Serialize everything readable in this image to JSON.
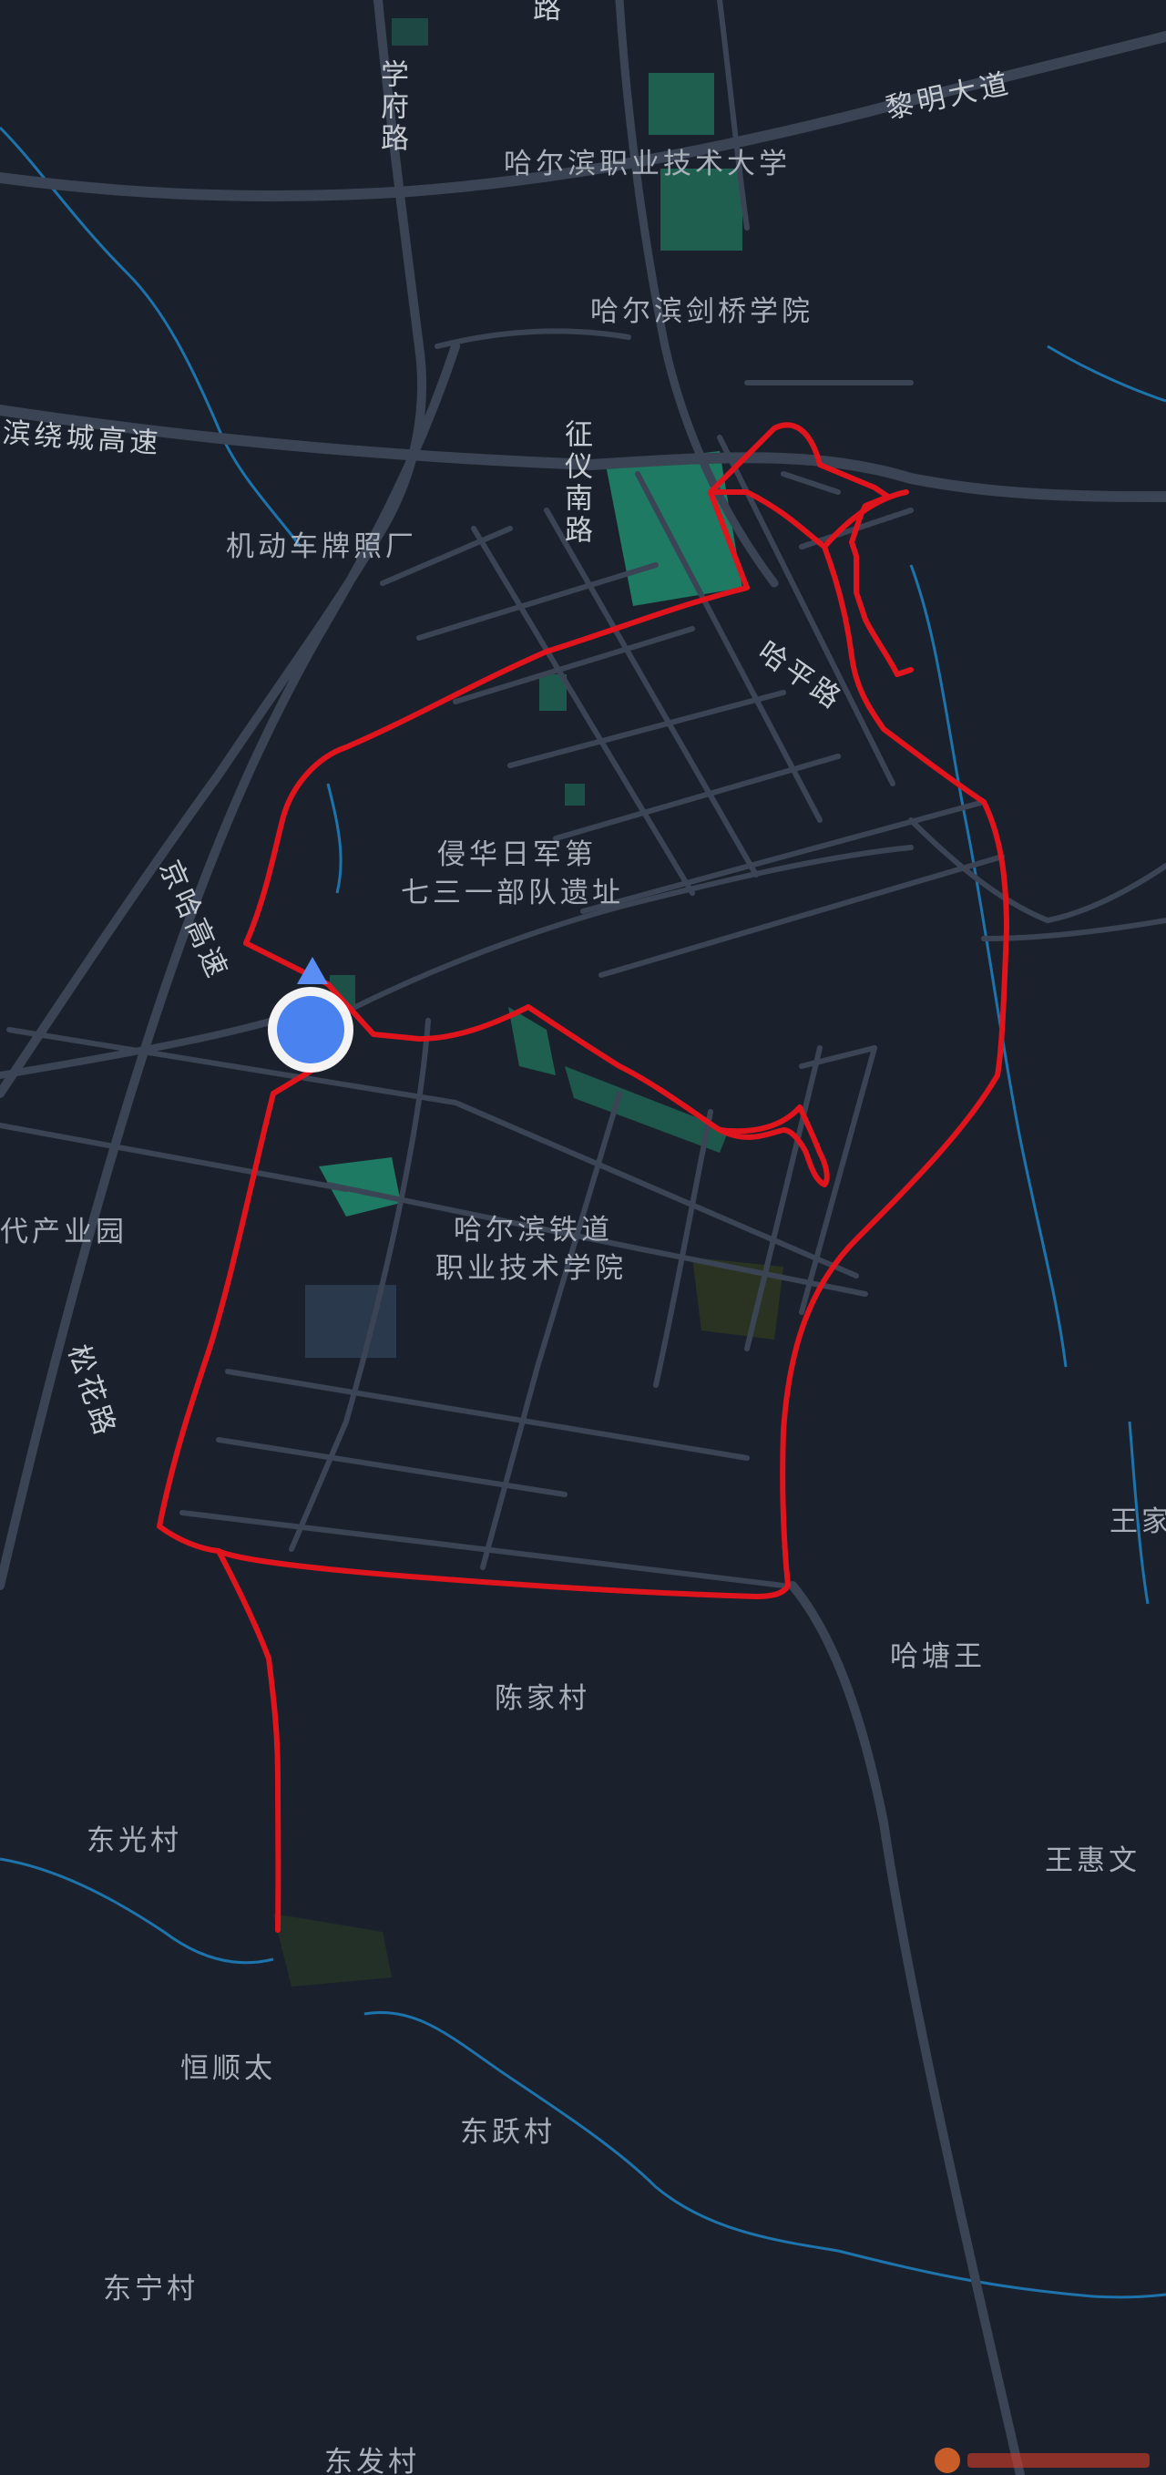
{
  "map": {
    "background": "#1b212c",
    "road_color": "#3b4454",
    "water_color": "#1f8fd6",
    "park_color": "#1f6f5a",
    "route_color": "#e0141c",
    "location_color": "#4a82f0"
  },
  "labels": {
    "xuefu_road_top": "路",
    "xuefu_road": "学府路",
    "liming_avenue": "黎明大道",
    "harbin_vocational_tech_univ": "哈尔滨职业技术大学",
    "harbin_cambridge_college": "哈尔滨剑桥学院",
    "ring_expressway": "滨绕城高速",
    "zhengyi_south_road": "征仪南路",
    "motor_vehicle_plate": "机动车牌照厂",
    "haping_road": "哈平路",
    "unit731_line1": "侵华日军第",
    "unit731_line2": "七三一部队遗址",
    "jingha_expressway": "京哈高速",
    "industrial_park": "代产业园",
    "railway_college_line1": "哈尔滨铁道",
    "railway_college_line2": "职业技术学院",
    "songhua_road": "松花路",
    "wangjia": "王家",
    "hatangwang": "哈塘王",
    "chenjia_village": "陈家村",
    "wanghuiwen": "王惠文",
    "dongguang_village": "东光村",
    "hengshuntai": "恒顺太",
    "dongyue_village": "东跃村",
    "dongning_village": "东宁村",
    "dongfa_village": "东发村"
  }
}
